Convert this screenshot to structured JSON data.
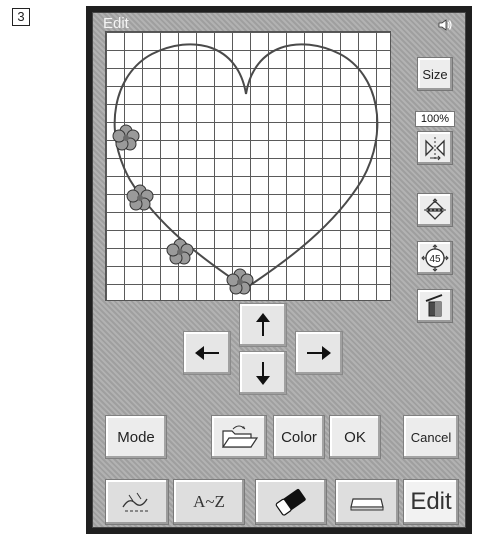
{
  "step": "3",
  "window": {
    "title": "Edit"
  },
  "side_panel": {
    "size_label": "Size",
    "zoom_level": "100%"
  },
  "bottom_row": {
    "mode_label": "Mode",
    "color_label": "Color",
    "ok_label": "OK",
    "cancel_label": "Cancel"
  },
  "tabs": {
    "alphabet_label": "A~Z",
    "edit_label": "Edit"
  },
  "colors": {
    "screen_bg": "#a9a9a9",
    "panel_bg": "#1f1f1f",
    "flower": "#9a9a9a"
  }
}
